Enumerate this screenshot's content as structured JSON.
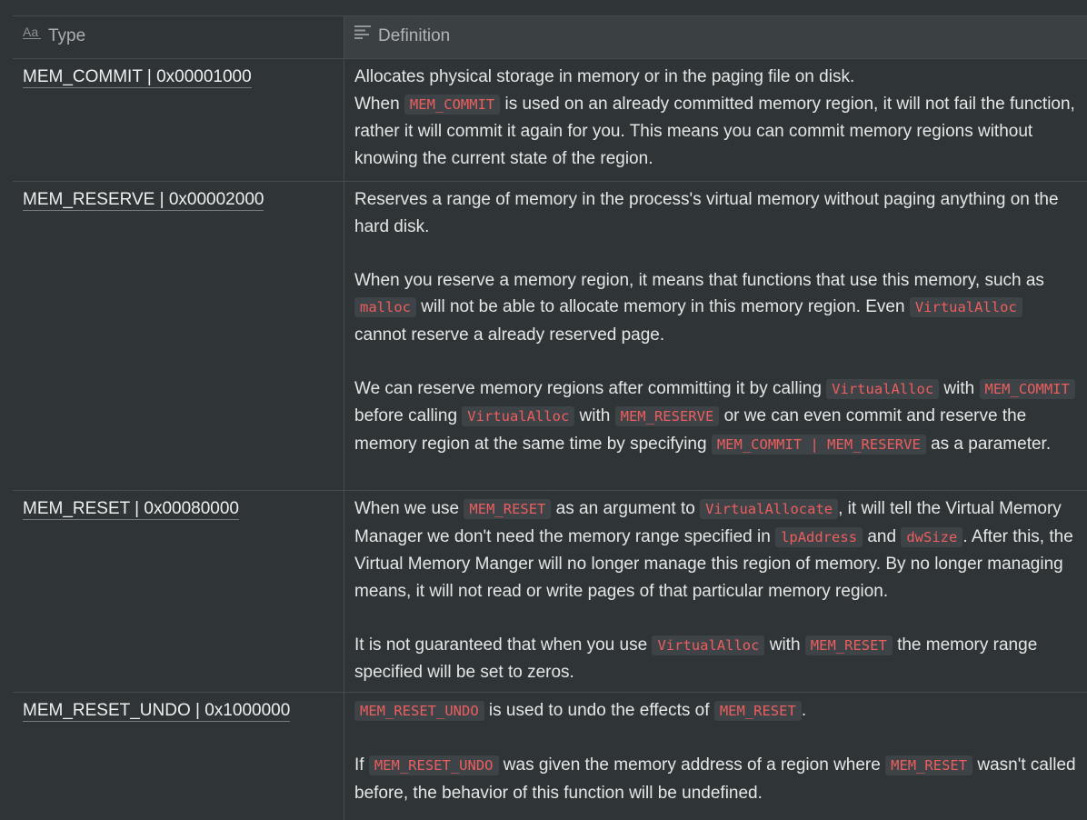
{
  "header": {
    "type_label": "Type",
    "definition_label": "Definition",
    "type_icon": "text-type-icon",
    "definition_icon": "text-lines-icon"
  },
  "rows": [
    {
      "type": "MEM_COMMIT | 0x00001000",
      "p1": "Allocates physical storage in memory or in the paging file on disk.",
      "p2_a": "When ",
      "p2_code1": "MEM_COMMIT",
      "p2_b": " is used on an already committed memory region, it will not fail the function, rather it will commit it again for you. This means you can commit memory regions without knowing the current state of the region."
    },
    {
      "type": "MEM_RESERVE | 0x00002000",
      "p1": "Reserves a range of memory in the process's virtual memory without paging anything on the hard disk.",
      "p2_a": "When you reserve a memory region, it means that functions that use this memory, such as ",
      "p2_code1": "malloc",
      "p2_b": " will not be able to allocate memory in this memory region.  Even ",
      "p2_code2": "VirtualAlloc",
      "p2_c": " cannot reserve a already reserved page.",
      "p3_a": "We can reserve memory regions after committing it by calling ",
      "p3_code1": "VirtualAlloc",
      "p3_b": " with ",
      "p3_code2": "MEM_COMMIT",
      "p3_c": " before calling ",
      "p3_code3": "VirtualAlloc",
      "p3_d": " with ",
      "p3_code4": "MEM_RESERVE",
      "p3_e": " or we can even commit and reserve the memory region at the same time by specifying ",
      "p3_code5": "MEM_COMMIT | MEM_RESERVE",
      "p3_f": " as a parameter."
    },
    {
      "type": "MEM_RESET | 0x00080000",
      "p1_a": "When we use ",
      "p1_code1": "MEM_RESET",
      "p1_b": " as an argument to ",
      "p1_code2": "VirtualAllocate",
      "p1_c": ", it will tell the Virtual Memory Manager we don't need the memory range specified in ",
      "p1_code3": "lpAddress",
      "p1_d": " and ",
      "p1_code4": "dwSize",
      "p1_e": ". After this, the Virtual Memory Manger will no longer manage this region of memory. By no longer managing means, it will not read or write pages of that particular memory region.",
      "p2_a": "It is not guaranteed that when you use ",
      "p2_code1": "VirtualAlloc",
      "p2_b": " with ",
      "p2_code2": "MEM_RESET",
      "p2_c": " the memory range specified will be set to zeros."
    },
    {
      "type": "MEM_RESET_UNDO | 0x1000000",
      "p1_code1": "MEM_RESET_UNDO",
      "p1_a": " is used to undo the effects of ",
      "p1_code2": "MEM_RESET",
      "p1_b": ".",
      "p2_a": "If ",
      "p2_code1": "MEM_RESET_UNDO",
      "p2_b": " was given the memory address of a region where ",
      "p2_code2": "MEM_RESET",
      "p2_c": " wasn't called before, the behavior of this function will be undefined."
    }
  ],
  "colors": {
    "background": "#2f3437",
    "header_highlight": "#3b4043",
    "border": "#454b4e",
    "code_text": "#ec5e5e",
    "code_bg": "#3e4347"
  }
}
